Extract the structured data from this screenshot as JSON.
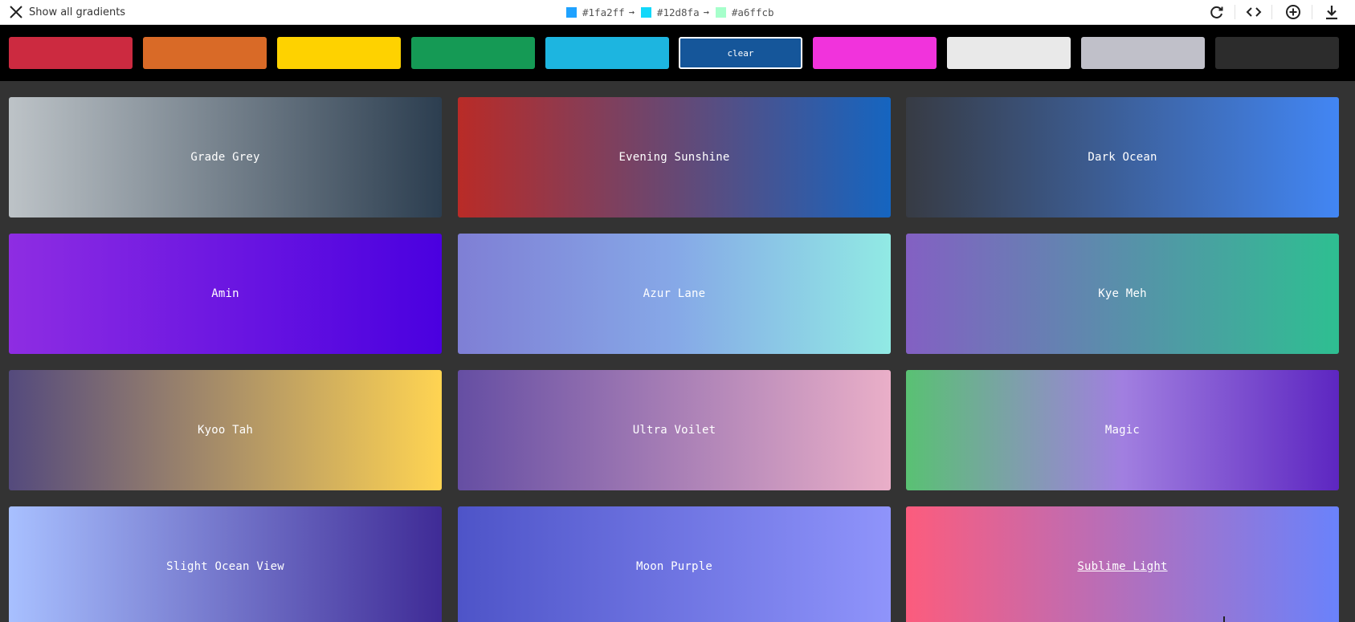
{
  "header": {
    "show_all_label": "Show all gradients",
    "chips": [
      {
        "hex": "#1fa2ff",
        "label": "#1fa2ff",
        "arrow": "→"
      },
      {
        "hex": "#12d8fa",
        "label": "#12d8fa",
        "arrow": "→"
      },
      {
        "hex": "#a6ffcb",
        "label": "#a6ffcb",
        "arrow": ""
      }
    ],
    "tools": [
      "refresh-icon",
      "code-icon",
      "add-circle-icon",
      "download-icon"
    ]
  },
  "filters": [
    {
      "name": "red",
      "color": "#cc2a40",
      "label": ""
    },
    {
      "name": "orange",
      "color": "#d96a27",
      "label": ""
    },
    {
      "name": "yellow",
      "color": "#fed200",
      "label": ""
    },
    {
      "name": "green",
      "color": "#159a55",
      "label": ""
    },
    {
      "name": "cyan",
      "color": "#1db5e0",
      "label": ""
    },
    {
      "name": "blue",
      "color": "#15569a",
      "label": "clear",
      "active": true
    },
    {
      "name": "magenta",
      "color": "#f133dc",
      "label": ""
    },
    {
      "name": "white",
      "color": "#e9e9e9",
      "label": ""
    },
    {
      "name": "grey",
      "color": "#c0c0c9",
      "label": ""
    },
    {
      "name": "black",
      "color": "#2c2c2c",
      "label": ""
    }
  ],
  "gradients": [
    {
      "name": "Grade Grey",
      "from": "#bdc3c7",
      "to": "#2c3e50"
    },
    {
      "name": "Evening Sunshine",
      "from": "#b92b27",
      "to": "#1565c0"
    },
    {
      "name": "Dark Ocean",
      "from": "#373b44",
      "to": "#4286f4"
    },
    {
      "name": "Amin",
      "from": "#8e2de2",
      "to": "#4a00e0"
    },
    {
      "name": "Azur Lane",
      "from": "#7f7fd5",
      "via": "#86a8e7",
      "to": "#91eae4"
    },
    {
      "name": "Kye Meh",
      "from": "#8360c3",
      "to": "#2ebf91"
    },
    {
      "name": "Kyoo Tah",
      "from": "#544a7d",
      "to": "#ffd452"
    },
    {
      "name": "Ultra Voilet",
      "from": "#654ea3",
      "to": "#eaafc8"
    },
    {
      "name": "Magic",
      "from": "#59c173",
      "via": "#a17fe0",
      "to": "#5d26c1"
    },
    {
      "name": "Slight Ocean View",
      "from": "#a8c0ff",
      "to": "#3f2b96"
    },
    {
      "name": "Moon Purple",
      "from": "#4e54c8",
      "to": "#8f94fb"
    },
    {
      "name": "Sublime Light",
      "from": "#fc5c7d",
      "to": "#6a82fb",
      "hovered": true
    }
  ]
}
